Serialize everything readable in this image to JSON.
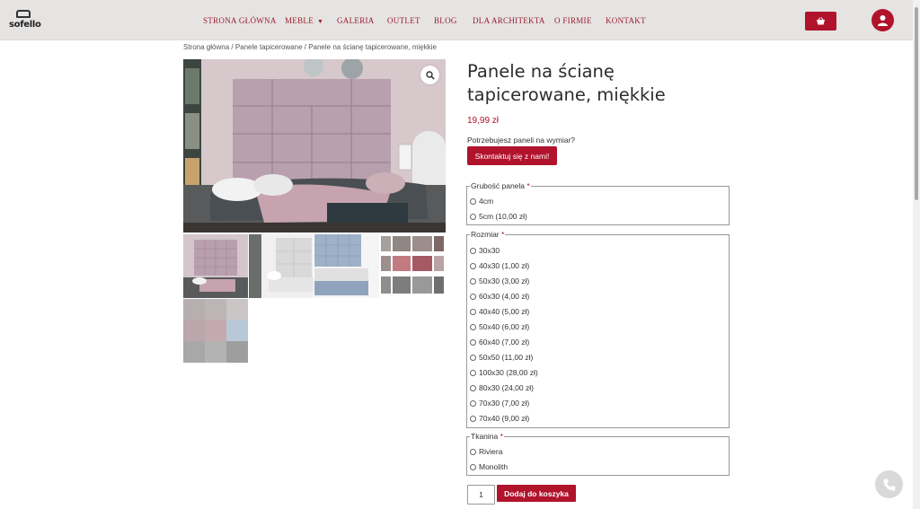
{
  "logo": {
    "text": "sofello"
  },
  "nav": {
    "items": [
      {
        "label": "STRONA GŁÓWNA"
      },
      {
        "label": "MEBLE"
      },
      {
        "label": "GALERIA"
      },
      {
        "label": "OUTLET"
      },
      {
        "label": "BLOG"
      },
      {
        "label": "DLA ARCHITEKTA"
      },
      {
        "label": "O FIRMIE"
      },
      {
        "label": "KONTAKT"
      }
    ]
  },
  "breadcrumb": "Strona główna / Panele tapicerowane / Panele na ścianę tapicerowane, miękkie",
  "product": {
    "title": "Panele na ścianę tapicerowane, miękkie",
    "price": "19,99 zł",
    "question": "Potrzebujesz paneli na wymiar?",
    "contact_button": "Skontaktuj się z nami!"
  },
  "options": {
    "thickness": {
      "legend": "Grubość panela",
      "required_mark": "*",
      "items": [
        "4cm",
        "5cm (10,00 zł)"
      ]
    },
    "size": {
      "legend": "Rozmiar",
      "required_mark": "*",
      "items": [
        "30x30",
        "40x30 (1,00 zł)",
        "50x30 (3,00 zł)",
        "60x30 (4,00 zł)",
        "40x40 (5,00 zł)",
        "50x40 (6,00 zł)",
        "60x40 (7,00 zł)",
        "50x50 (11,00 zł)",
        "100x30 (28,00 zł)",
        "80x30 (24,00 zł)",
        "70x30 (7,00 zł)",
        "70x40 (9,00 zł)"
      ]
    },
    "fabric": {
      "legend": "Tkanina",
      "required_mark": "*",
      "items": [
        "Riviera",
        "Monolith"
      ]
    }
  },
  "cart": {
    "quantity": "1",
    "add_button": "Dodaj do koszyka"
  },
  "colors": {
    "brand": "#b0132b",
    "nav_text": "#9b1c2c",
    "header_bg": "#e6e4e3"
  }
}
